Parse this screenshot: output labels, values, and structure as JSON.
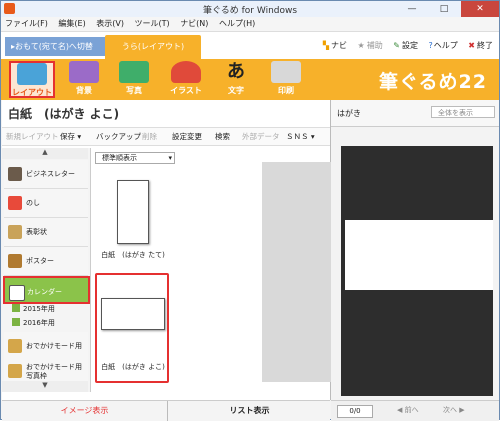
{
  "window": {
    "title": "筆ぐるめ for Windows",
    "controls": {
      "minimize": "—",
      "maximize": "□",
      "close": "✕"
    }
  },
  "menu": [
    "ファイル(F)",
    "編集(E)",
    "表示(V)",
    "ツール(T)",
    "ナビ(N)",
    "ヘルプ(H)"
  ],
  "tabs": {
    "front_label": "▸おもて(宛て名)へ切替",
    "back_label": "うら(レイアウト)"
  },
  "helpers": {
    "navi": "ナビ",
    "hojo": "補助",
    "settei": "設定",
    "help": "ヘルプ",
    "quit": "終了"
  },
  "ribbon": {
    "layout": "レイアウト",
    "haikei": "背景",
    "shashin": "写真",
    "illust": "イラスト",
    "moji": "文字",
    "insatsu": "印刷",
    "brand": "筆ぐるめ22"
  },
  "main": {
    "heading": "白紙　(はがき よこ)",
    "toolbar": {
      "new_layout": "新規レイアウト",
      "save": "保存 ▾",
      "backup": "バックアップ",
      "delete": "削除",
      "settings": "設定変更",
      "search": "検索",
      "external": "外部データ",
      "sns": "ＳＮＳ ▾"
    },
    "sort_select": "標準順表示"
  },
  "categories": [
    {
      "label": "ビジネスレター"
    },
    {
      "label": "のし"
    },
    {
      "label": "表彰状"
    },
    {
      "label": "ポスター"
    },
    {
      "label": "カレンダー"
    }
  ],
  "subcategories": [
    "2015年用",
    "2016年用"
  ],
  "more_categories": [
    "おでかけモード用",
    "おでかけモード用写真枠"
  ],
  "thumbnails": [
    {
      "label": "白紙　(はがき たて)"
    },
    {
      "label": "白紙　(はがき よこ)"
    }
  ],
  "bottom": {
    "image_view": "イメージ表示",
    "list_view": "リスト表示"
  },
  "preview": {
    "title": "はがき",
    "zoom_select": "全体を表示",
    "page": "0/0",
    "prev": "◀ 前へ",
    "next": "次へ ▶"
  },
  "colors": {
    "ribbon": "#f7b12a",
    "selection": "#e53030",
    "calendar_green": "#8bc34a",
    "front_tab": "#7aa2d6"
  }
}
